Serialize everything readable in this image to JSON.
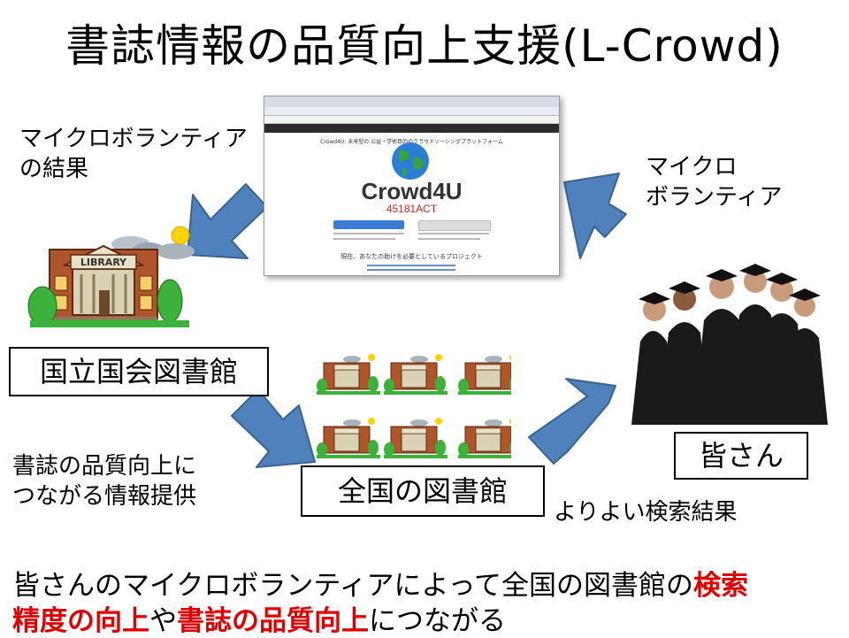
{
  "title": "書誌情報の品質向上支援(L-Crowd)",
  "labels": {
    "micro_result": [
      "マイクロボランティア",
      "の結果"
    ],
    "micro_volunteer": [
      "マイクロ",
      "ボランティア"
    ],
    "ndl": "国立国会図書館",
    "info_provision": [
      "書誌の品質向上に",
      "つながる情報提供"
    ],
    "national_libraries": "全国の図書館",
    "everyone": "皆さん",
    "better_search": "よりよい検索結果"
  },
  "library_sign": "LIBRARY",
  "screenshot": {
    "logo": "Crowd4U",
    "code": "45181ACT",
    "subtitle": "Crowd4U: 未来型の 公益・学術目的のクラウドソーシングプラットフォーム",
    "project_heading": "現在、あなたの助けを必要としているプロジェクト"
  },
  "footer": {
    "line1_parts": [
      "皆さんのマイクロボランティアによって全国の図書館の",
      "検索"
    ],
    "line2_parts": [
      "精度の向上",
      "や",
      "書誌の品質向上",
      "につながる"
    ]
  },
  "colors": {
    "arrow_fill": "#4f81bd",
    "arrow_stroke": "#3a6390",
    "highlight": "#e00000"
  }
}
